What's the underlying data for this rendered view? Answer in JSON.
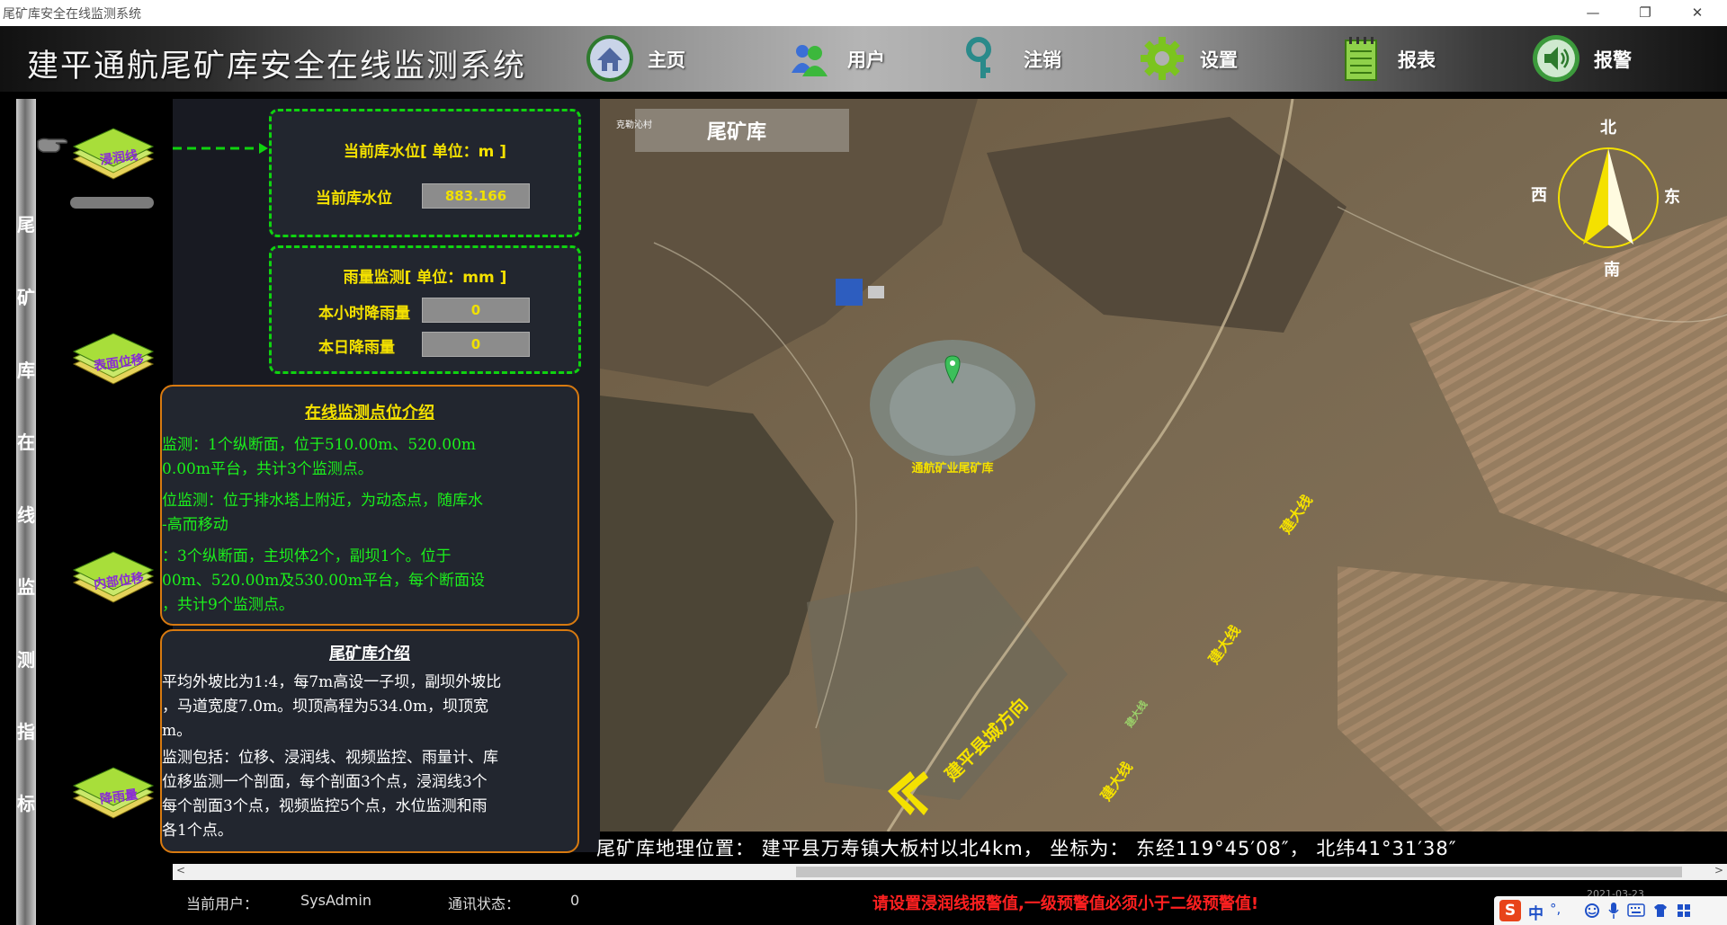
{
  "window": {
    "title": "尾矿库安全在线监测系统",
    "minimize": "—",
    "restore": "❐",
    "close": "✕"
  },
  "header": {
    "app_title": "建平通航尾矿库安全在线监测系统",
    "nav": [
      {
        "label": "主页",
        "icon": "home-icon"
      },
      {
        "label": "用户",
        "icon": "users-icon"
      },
      {
        "label": "注销",
        "icon": "key-icon"
      },
      {
        "label": "设置",
        "icon": "gear-icon"
      },
      {
        "label": "报表",
        "icon": "notepad-icon"
      },
      {
        "label": "报警",
        "icon": "speaker-icon"
      }
    ]
  },
  "sidebar": {
    "vertical_title": [
      "尾",
      "矿",
      "库",
      "在",
      "线",
      "监",
      "测",
      "指",
      "标"
    ],
    "buttons": [
      "浸润线",
      "表面位移",
      "内部位移",
      "降雨量"
    ]
  },
  "water_level": {
    "title": "当前库水位[ 单位：m ]",
    "label": "当前库水位",
    "value": "883.166"
  },
  "rainfall": {
    "title": "雨量监测[ 单位：mm ]",
    "hour_label": "本小时降雨量",
    "hour_value": "0",
    "day_label": "本日降雨量",
    "day_value": "0"
  },
  "monitor_intro": {
    "title": "在线监测点位介绍",
    "lines": [
      "监测：1个纵断面，位于510.00m、520.00m",
      "0.00m平台，共计3个监测点。",
      "位监测：位于排水塔上附近，为动态点，随库水",
      "-高而移动",
      "：3个纵断面，主坝体2个，副坝1个。位于",
      "00m、520.00m及530.00m平台，每个断面设",
      "，共计9个监测点。"
    ]
  },
  "tailings_intro": {
    "title": "尾矿库介绍",
    "lines": [
      "平均外坡比为1:4，每7m高设一子坝，副坝外坡比",
      "，马道宽度7.0m。坝顶高程为534.0m，坝顶宽",
      "m。",
      "监测包括：位移、浸润线、视频监控、雨量计、库",
      "位移监测一个剖面，每个剖面3个点，浸润线3个",
      "每个剖面3个点，视频监控5个点，水位监测和雨",
      "各1个点。"
    ]
  },
  "map": {
    "label": "尾矿库",
    "marker_label": "通航矿业尾矿库",
    "compass": {
      "n": "北",
      "s": "南",
      "e": "东",
      "w": "西"
    },
    "roads": [
      "建大线",
      "建大线",
      "建大线",
      "建大线"
    ],
    "direction": "建平县城方向",
    "corner_text": "克勒沁村",
    "ticker": "尾矿库地理位置：  建平县万寿镇大板村以北4km，  坐标为：  东经119°45′08″，  北纬41°31′38″"
  },
  "status": {
    "user_label": "当前用户：",
    "user": "SysAdmin",
    "comm_label": "通讯状态：",
    "comm": "0",
    "warning": "请设置浸润线报警值,一级预警值必须小于二级预警值!",
    "clock": "2021-03-23"
  },
  "tray": {
    "ime_logo": "S",
    "ime_mode": "中",
    "symbols": "°,"
  },
  "colors": {
    "accent_yellow": "#f4e100",
    "green": "#0fd30f",
    "orange": "#d87a10",
    "warn_red": "#ff2020"
  }
}
